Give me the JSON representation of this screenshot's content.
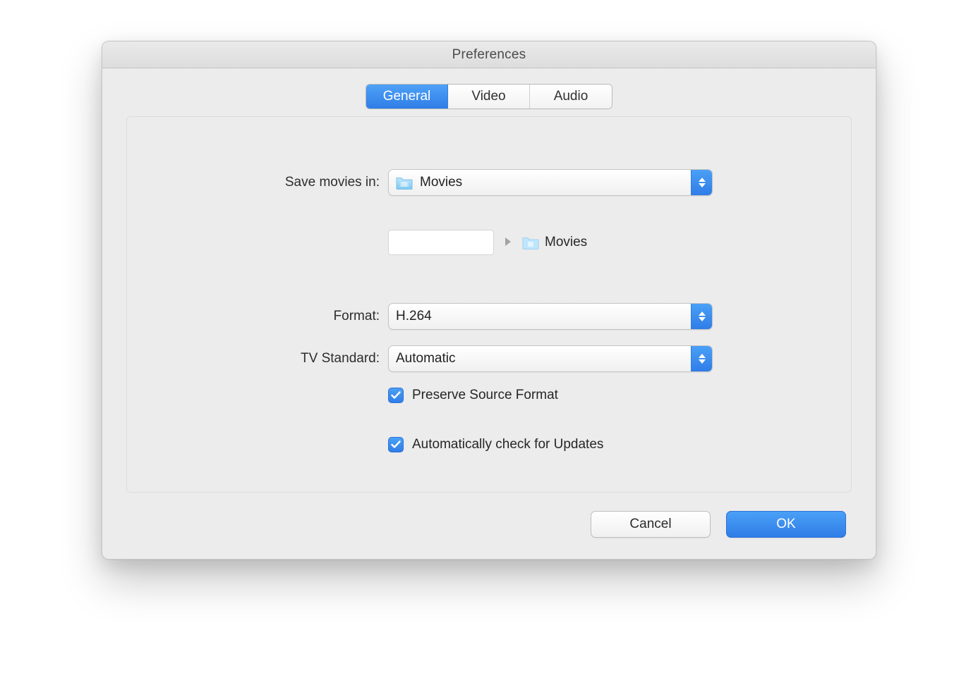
{
  "window": {
    "title": "Preferences"
  },
  "tabs": {
    "general": "General",
    "video": "Video",
    "audio": "Audio",
    "selected": "general"
  },
  "labels": {
    "save_movies_in": "Save movies in:",
    "format": "Format:",
    "tv_standard": "TV Standard:"
  },
  "fields": {
    "save_location": {
      "value": "Movies",
      "path_label": "Movies"
    },
    "format": {
      "value": "H.264"
    },
    "tv_standard": {
      "value": "Automatic"
    }
  },
  "checks": {
    "preserve_source_format": {
      "label": "Preserve Source Format",
      "checked": true
    },
    "auto_update": {
      "label": "Automatically check for Updates",
      "checked": true
    }
  },
  "buttons": {
    "cancel": "Cancel",
    "ok": "OK"
  },
  "colors": {
    "accent": "#2f7de7"
  }
}
